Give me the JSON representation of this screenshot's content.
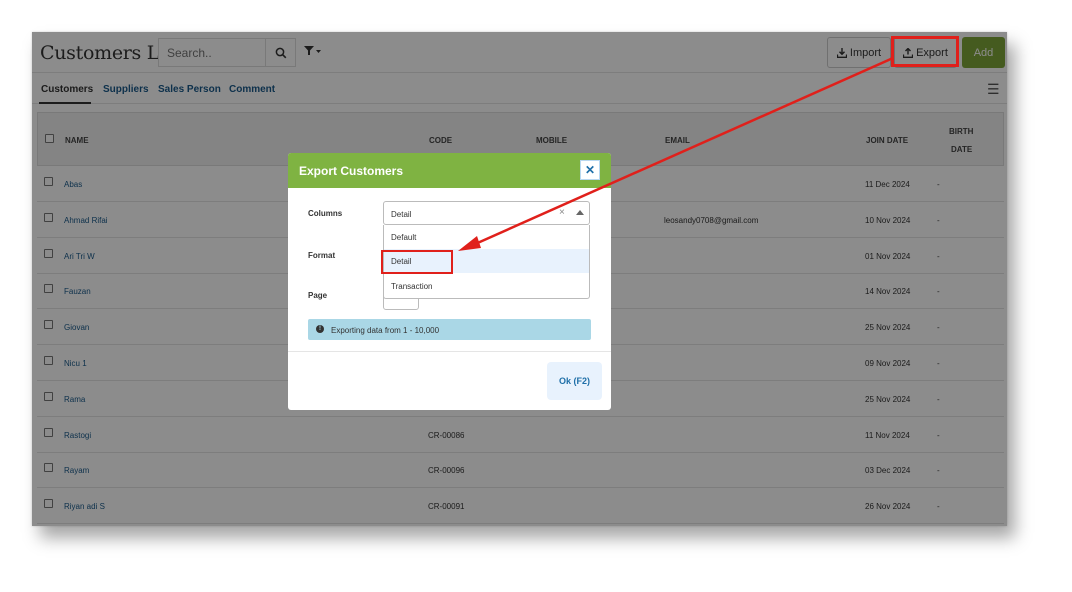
{
  "header": {
    "title": "Customers List",
    "search_placeholder": "Search..",
    "import_label": "Import",
    "export_label": "Export",
    "add_label": "Add"
  },
  "tabs": [
    {
      "label": "Customers",
      "active": true
    },
    {
      "label": "Suppliers",
      "active": false
    },
    {
      "label": "Sales Person",
      "active": false
    },
    {
      "label": "Comment",
      "active": false
    }
  ],
  "table": {
    "columns": {
      "name": "NAME",
      "code": "CODE",
      "mobile": "MOBILE",
      "email": "EMAIL",
      "join_date": "JOIN DATE",
      "birth_date_1": "BIRTH",
      "birth_date_2": "DATE"
    },
    "rows": [
      {
        "name": "Abas",
        "code": "",
        "email": "",
        "join_date": "11 Dec 2024",
        "birth_date": "-"
      },
      {
        "name": "Ahmad Rifai",
        "code": "",
        "email": "leosandy0708@gmail.com",
        "join_date": "10 Nov 2024",
        "birth_date": "-"
      },
      {
        "name": "Ari Tri W",
        "code": "",
        "email": "",
        "join_date": "01 Nov 2024",
        "birth_date": "-"
      },
      {
        "name": "Fauzan",
        "code": "",
        "email": "",
        "join_date": "14 Nov 2024",
        "birth_date": "-"
      },
      {
        "name": "Giovan",
        "code": "",
        "email": "",
        "join_date": "25 Nov 2024",
        "birth_date": "-"
      },
      {
        "name": "Nicu 1",
        "code": "",
        "email": "",
        "join_date": "09 Nov 2024",
        "birth_date": "-"
      },
      {
        "name": "Rama",
        "code": "",
        "email": "",
        "join_date": "25 Nov 2024",
        "birth_date": "-"
      },
      {
        "name": "Rastogi",
        "code": "CR-00086",
        "email": "",
        "join_date": "11 Nov 2024",
        "birth_date": "-"
      },
      {
        "name": "Rayam",
        "code": "CR-00096",
        "email": "",
        "join_date": "03 Dec 2024",
        "birth_date": "-"
      },
      {
        "name": "Riyan adi S",
        "code": "CR-00091",
        "email": "",
        "join_date": "26 Nov 2024",
        "birth_date": "-"
      }
    ]
  },
  "modal": {
    "title": "Export Customers",
    "close_label": "✕",
    "columns_label": "Columns",
    "format_label": "Format",
    "page_label": "Page",
    "columns_value": "Detail",
    "clear_label": "×",
    "options": [
      "Default",
      "Detail",
      "Transaction"
    ],
    "info_icon": "!",
    "info_text": "Exporting data from 1 - 10,000",
    "ok_label": "Ok (F2)"
  },
  "colors": {
    "accent_green": "#7fb342",
    "add_button": "#7fa73a",
    "link_blue": "#1a5a8a",
    "annotation_red": "#e0201b",
    "info_bg": "#aad7e6"
  }
}
